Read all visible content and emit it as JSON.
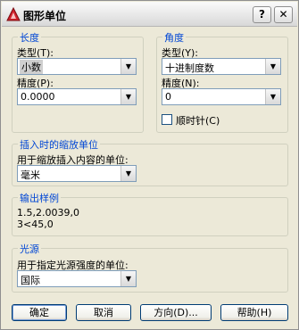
{
  "window": {
    "title": "图形单位",
    "help_glyph": "?",
    "close_glyph": "✕"
  },
  "length": {
    "group_title": "长度",
    "type_label": "类型(T):",
    "type_value": "小数",
    "precision_label": "精度(P):",
    "precision_value": "0.0000"
  },
  "angle": {
    "group_title": "角度",
    "type_label": "类型(Y):",
    "type_value": "十进制度数",
    "precision_label": "精度(N):",
    "precision_value": "0",
    "clockwise_label": "顺时针(C)",
    "clockwise_checked": false
  },
  "insertion": {
    "group_title": "插入时的缩放单位",
    "description": "用于缩放插入内容的单位:",
    "value": "毫米"
  },
  "sample_output": {
    "group_title": "输出样例",
    "lines": [
      "1.5,2.0039,0",
      "3<45,0"
    ]
  },
  "lighting": {
    "group_title": "光源",
    "description": "用于指定光源强度的单位:",
    "value": "国际"
  },
  "buttons": {
    "ok": "确定",
    "cancel": "取消",
    "direction": "方向(D)...",
    "help": "帮助(H)"
  },
  "icons": {
    "app": "autocad-app-icon",
    "dropdown": "chevron-down-icon",
    "dropdown_glyph": "▼"
  }
}
